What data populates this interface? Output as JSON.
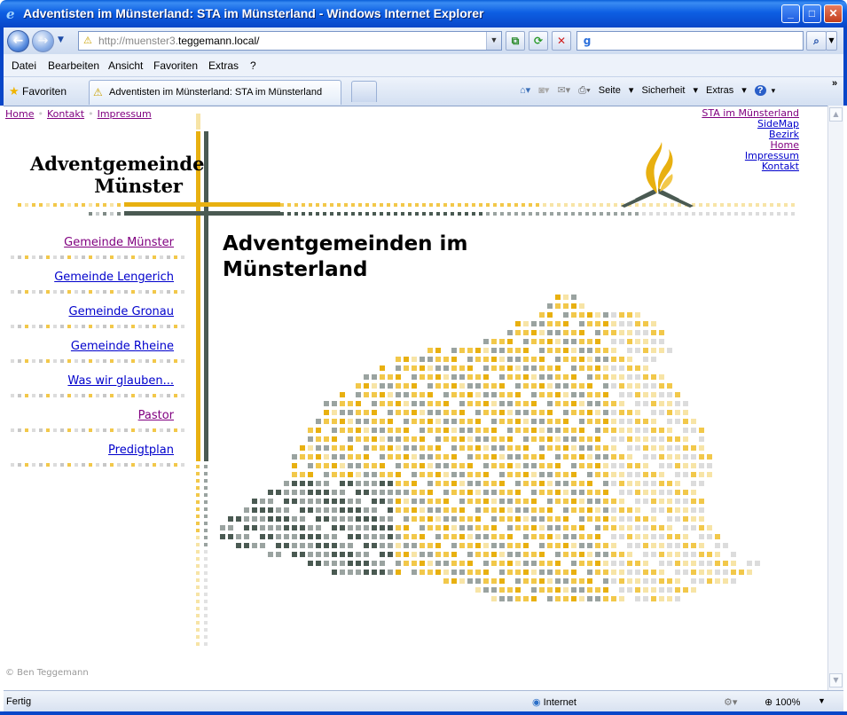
{
  "window": {
    "title": "Adventisten im Münsterland: STA im Münsterland - Windows Internet Explorer",
    "controls": [
      "minimize",
      "maximize",
      "close"
    ]
  },
  "address": {
    "url_prefix": "http://muenster3.",
    "url_host": "teggemann.local/",
    "search_value": ""
  },
  "menu": [
    "Datei",
    "Bearbeiten",
    "Ansicht",
    "Favoriten",
    "Extras",
    "?"
  ],
  "favorites_bar": {
    "favorites_label": "Favoriten",
    "tab_title": "Adventisten im Münsterland: STA im Münsterland",
    "commands": {
      "page": "Seite",
      "safety": "Sicherheit",
      "tools": "Extras"
    }
  },
  "page": {
    "top_nav": [
      "Home",
      "Kontakt",
      "Impressum"
    ],
    "right_nav": [
      "STA im Münsterland",
      "SideMap",
      "Bezirk",
      "Home",
      "Impressum",
      "Kontakt"
    ],
    "brand_line1": "Adventgemeinde",
    "brand_line2": "Münster",
    "side_nav": [
      "Gemeinde Münster",
      "Gemeinde Lengerich",
      "Gemeinde Gronau",
      "Gemeinde Rheine",
      "Was wir glauben...",
      "Pastor",
      "Predigtplan"
    ],
    "heading_line1": "Adventgemeinden im",
    "heading_line2": "Münsterland",
    "footer": "© Ben Teggemann"
  },
  "status": {
    "text": "Fertig",
    "zone": "Internet",
    "zoom": "100%"
  },
  "colors": {
    "accent_gold": "#e8b010",
    "accent_dark": "#4a5a52",
    "link": "#0000cc",
    "visited": "#800080"
  }
}
